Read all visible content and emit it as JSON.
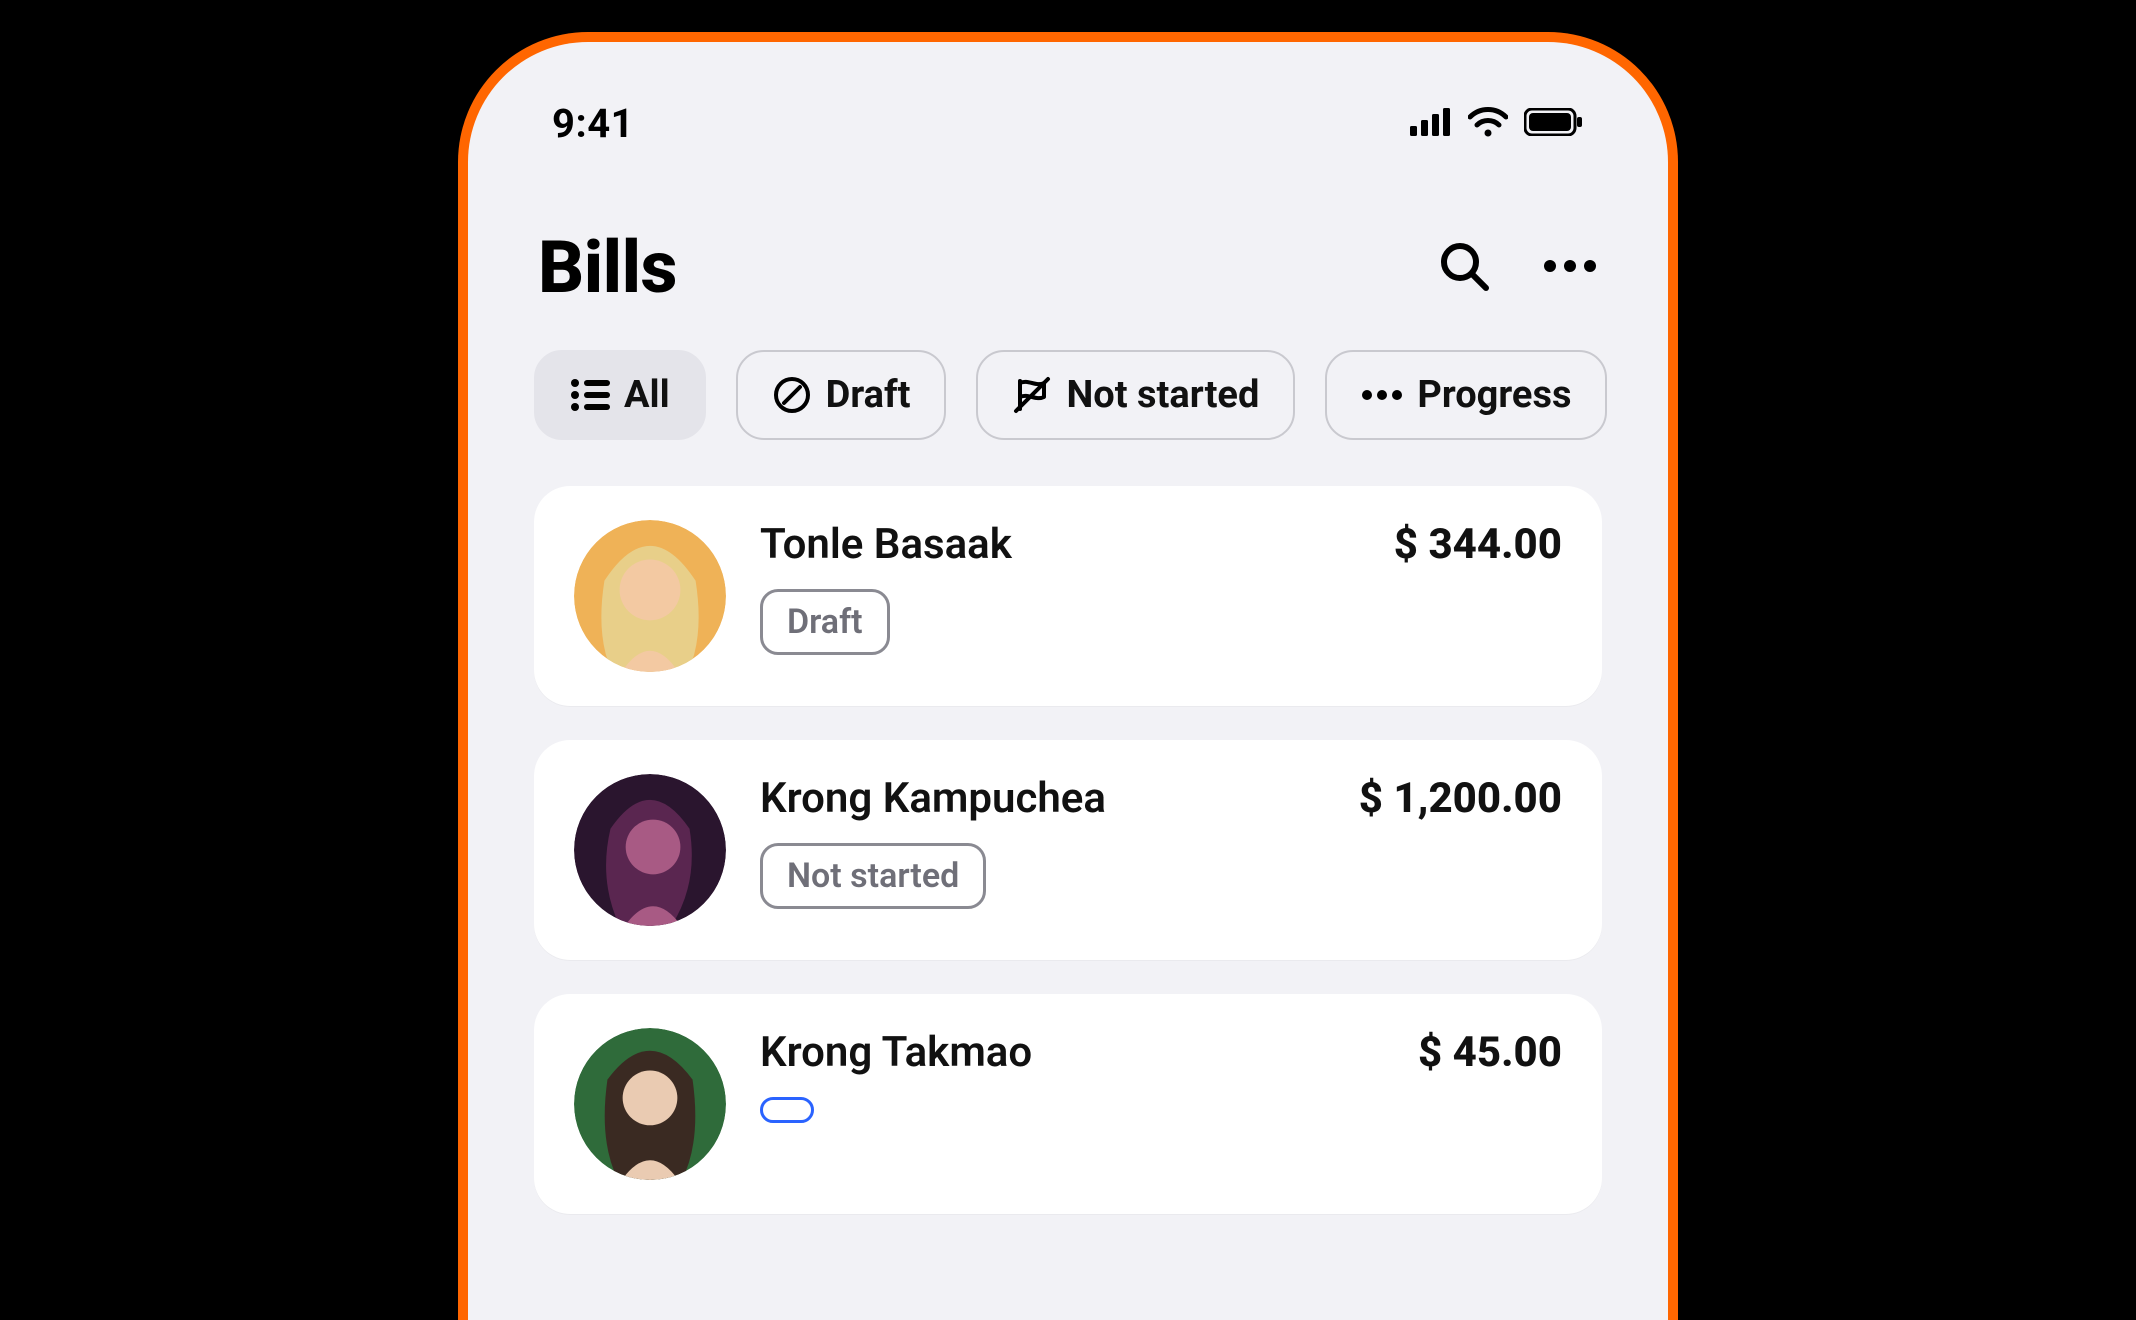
{
  "status": {
    "time": "9:41"
  },
  "header": {
    "title": "Bills"
  },
  "filters": {
    "all": "All",
    "draft": "Draft",
    "not_started": "Not started",
    "progress": "Progress"
  },
  "bills": [
    {
      "name": "Tonle Basaak",
      "amount": "$ 344.00",
      "status": "Draft",
      "status_variant": "default",
      "avatar": {
        "bg": "#efb257",
        "hair": "#e8cf89",
        "skin": "#f3c9a2"
      }
    },
    {
      "name": "Krong Kampuchea",
      "amount": "$ 1,200.00",
      "status": "Not started",
      "status_variant": "default",
      "avatar": {
        "bg": "#2a152e",
        "hair": "#5a2650",
        "skin": "#a85a84"
      }
    },
    {
      "name": "Krong Takmao",
      "amount": "$ 45.00",
      "status": "",
      "status_variant": "blue",
      "avatar": {
        "bg": "#2f6b3a",
        "hair": "#3a2a22",
        "skin": "#eacbb2"
      }
    }
  ]
}
